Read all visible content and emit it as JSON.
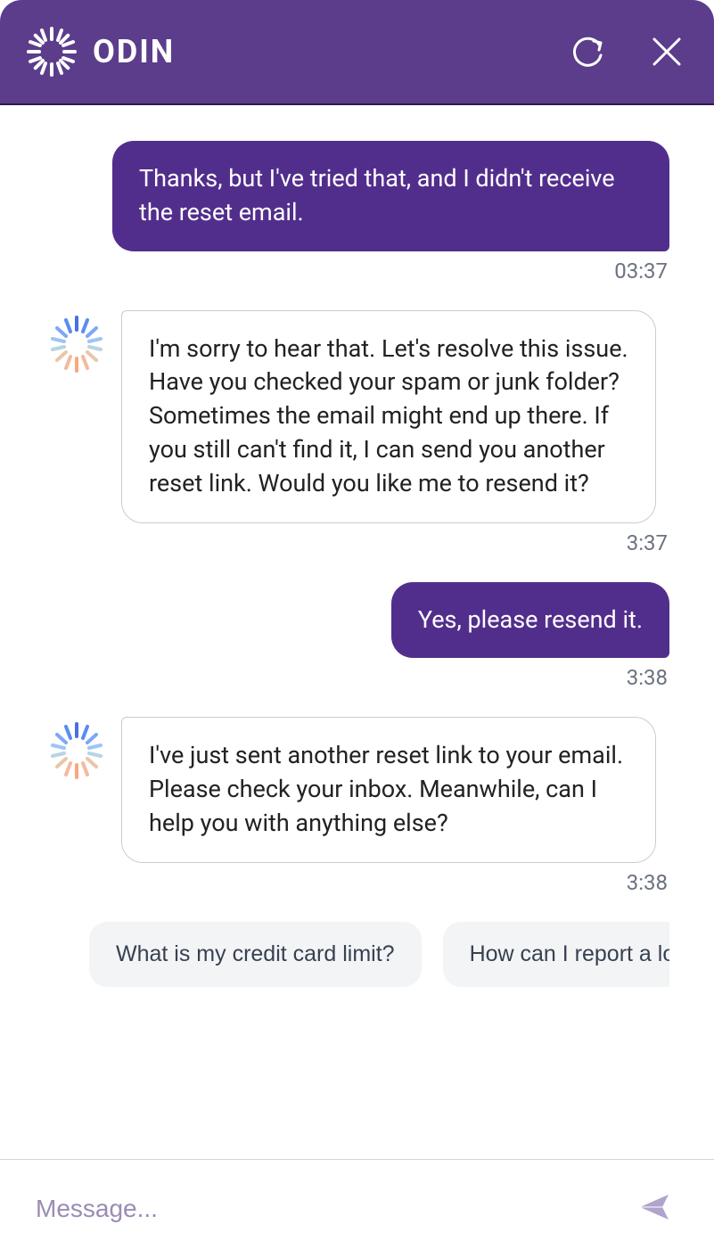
{
  "header": {
    "brand": "ODIN"
  },
  "messages": [
    {
      "role": "user",
      "text": "Thanks, but I've tried that, and I didn't receive the reset email.",
      "time": "03:37"
    },
    {
      "role": "bot",
      "text": "I'm sorry to hear that. Let's resolve this issue. Have you checked your spam or junk folder? Sometimes the email might end up there. If you still can't find it, I can send you another reset link. Would you like me to resend it?",
      "time": "3:37"
    },
    {
      "role": "user",
      "text": "Yes, please resend it.",
      "time": "3:38"
    },
    {
      "role": "bot",
      "text": "I've just sent another reset link to your email. Please check your inbox. Meanwhile, can I help you with anything else?",
      "time": "3:38"
    }
  ],
  "suggestions": [
    "What is my credit card limit?",
    "How can I report a lost or stol"
  ],
  "composer": {
    "placeholder": "Message..."
  }
}
